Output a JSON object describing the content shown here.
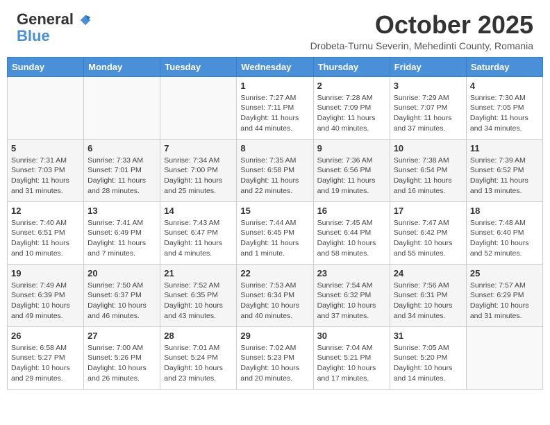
{
  "header": {
    "logo_general": "General",
    "logo_blue": "Blue",
    "month_title": "October 2025",
    "location": "Drobeta-Turnu Severin, Mehedinti County, Romania"
  },
  "days_of_week": [
    "Sunday",
    "Monday",
    "Tuesday",
    "Wednesday",
    "Thursday",
    "Friday",
    "Saturday"
  ],
  "weeks": [
    [
      {
        "num": "",
        "info": ""
      },
      {
        "num": "",
        "info": ""
      },
      {
        "num": "",
        "info": ""
      },
      {
        "num": "1",
        "info": "Sunrise: 7:27 AM\nSunset: 7:11 PM\nDaylight: 11 hours\nand 44 minutes."
      },
      {
        "num": "2",
        "info": "Sunrise: 7:28 AM\nSunset: 7:09 PM\nDaylight: 11 hours\nand 40 minutes."
      },
      {
        "num": "3",
        "info": "Sunrise: 7:29 AM\nSunset: 7:07 PM\nDaylight: 11 hours\nand 37 minutes."
      },
      {
        "num": "4",
        "info": "Sunrise: 7:30 AM\nSunset: 7:05 PM\nDaylight: 11 hours\nand 34 minutes."
      }
    ],
    [
      {
        "num": "5",
        "info": "Sunrise: 7:31 AM\nSunset: 7:03 PM\nDaylight: 11 hours\nand 31 minutes."
      },
      {
        "num": "6",
        "info": "Sunrise: 7:33 AM\nSunset: 7:01 PM\nDaylight: 11 hours\nand 28 minutes."
      },
      {
        "num": "7",
        "info": "Sunrise: 7:34 AM\nSunset: 7:00 PM\nDaylight: 11 hours\nand 25 minutes."
      },
      {
        "num": "8",
        "info": "Sunrise: 7:35 AM\nSunset: 6:58 PM\nDaylight: 11 hours\nand 22 minutes."
      },
      {
        "num": "9",
        "info": "Sunrise: 7:36 AM\nSunset: 6:56 PM\nDaylight: 11 hours\nand 19 minutes."
      },
      {
        "num": "10",
        "info": "Sunrise: 7:38 AM\nSunset: 6:54 PM\nDaylight: 11 hours\nand 16 minutes."
      },
      {
        "num": "11",
        "info": "Sunrise: 7:39 AM\nSunset: 6:52 PM\nDaylight: 11 hours\nand 13 minutes."
      }
    ],
    [
      {
        "num": "12",
        "info": "Sunrise: 7:40 AM\nSunset: 6:51 PM\nDaylight: 11 hours\nand 10 minutes."
      },
      {
        "num": "13",
        "info": "Sunrise: 7:41 AM\nSunset: 6:49 PM\nDaylight: 11 hours\nand 7 minutes."
      },
      {
        "num": "14",
        "info": "Sunrise: 7:43 AM\nSunset: 6:47 PM\nDaylight: 11 hours\nand 4 minutes."
      },
      {
        "num": "15",
        "info": "Sunrise: 7:44 AM\nSunset: 6:45 PM\nDaylight: 11 hours\nand 1 minute."
      },
      {
        "num": "16",
        "info": "Sunrise: 7:45 AM\nSunset: 6:44 PM\nDaylight: 10 hours\nand 58 minutes."
      },
      {
        "num": "17",
        "info": "Sunrise: 7:47 AM\nSunset: 6:42 PM\nDaylight: 10 hours\nand 55 minutes."
      },
      {
        "num": "18",
        "info": "Sunrise: 7:48 AM\nSunset: 6:40 PM\nDaylight: 10 hours\nand 52 minutes."
      }
    ],
    [
      {
        "num": "19",
        "info": "Sunrise: 7:49 AM\nSunset: 6:39 PM\nDaylight: 10 hours\nand 49 minutes."
      },
      {
        "num": "20",
        "info": "Sunrise: 7:50 AM\nSunset: 6:37 PM\nDaylight: 10 hours\nand 46 minutes."
      },
      {
        "num": "21",
        "info": "Sunrise: 7:52 AM\nSunset: 6:35 PM\nDaylight: 10 hours\nand 43 minutes."
      },
      {
        "num": "22",
        "info": "Sunrise: 7:53 AM\nSunset: 6:34 PM\nDaylight: 10 hours\nand 40 minutes."
      },
      {
        "num": "23",
        "info": "Sunrise: 7:54 AM\nSunset: 6:32 PM\nDaylight: 10 hours\nand 37 minutes."
      },
      {
        "num": "24",
        "info": "Sunrise: 7:56 AM\nSunset: 6:31 PM\nDaylight: 10 hours\nand 34 minutes."
      },
      {
        "num": "25",
        "info": "Sunrise: 7:57 AM\nSunset: 6:29 PM\nDaylight: 10 hours\nand 31 minutes."
      }
    ],
    [
      {
        "num": "26",
        "info": "Sunrise: 6:58 AM\nSunset: 5:27 PM\nDaylight: 10 hours\nand 29 minutes."
      },
      {
        "num": "27",
        "info": "Sunrise: 7:00 AM\nSunset: 5:26 PM\nDaylight: 10 hours\nand 26 minutes."
      },
      {
        "num": "28",
        "info": "Sunrise: 7:01 AM\nSunset: 5:24 PM\nDaylight: 10 hours\nand 23 minutes."
      },
      {
        "num": "29",
        "info": "Sunrise: 7:02 AM\nSunset: 5:23 PM\nDaylight: 10 hours\nand 20 minutes."
      },
      {
        "num": "30",
        "info": "Sunrise: 7:04 AM\nSunset: 5:21 PM\nDaylight: 10 hours\nand 17 minutes."
      },
      {
        "num": "31",
        "info": "Sunrise: 7:05 AM\nSunset: 5:20 PM\nDaylight: 10 hours\nand 14 minutes."
      },
      {
        "num": "",
        "info": ""
      }
    ]
  ]
}
